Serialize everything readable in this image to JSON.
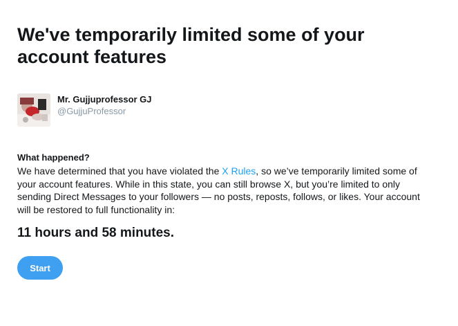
{
  "page": {
    "title": "We've temporarily limited some of your account features"
  },
  "account": {
    "display_name": "Mr. Gujjuprofessor GJ",
    "handle": "@GujjuProfessor"
  },
  "notice": {
    "heading": "What happened?",
    "text_before_link": "We have determined that you have violated the ",
    "link_label": "X Rules",
    "text_after_link": ", so we’ve temporarily limited some of your account features. While in this state, you can still browse X, but you’re limited to only sending Direct Messages to your followers — no posts, reposts, follows, or likes. Your account will be restored to full functionality in:"
  },
  "countdown": {
    "remaining": "11 hours and 58 minutes."
  },
  "actions": {
    "start_label": "Start"
  },
  "colors": {
    "link": "#1da1f2",
    "button": "#3f9ff0",
    "secondary_text": "#8899a6",
    "primary_text": "#14171a"
  }
}
